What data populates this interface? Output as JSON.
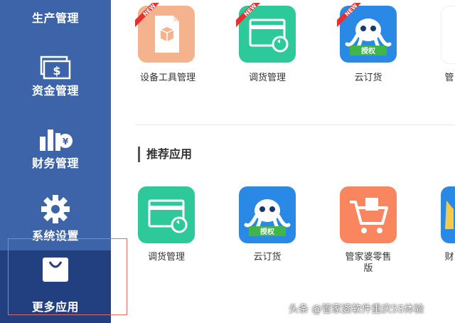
{
  "sidebar": {
    "items": [
      {
        "label": "生产管理",
        "icon": "production-icon"
      },
      {
        "label": "资金管理",
        "icon": "cash-icon"
      },
      {
        "label": "财务管理",
        "icon": "finance-chart-icon"
      },
      {
        "label": "系统设置",
        "icon": "gear-icon"
      },
      {
        "label": "更多应用",
        "icon": "shopping-bag-icon",
        "active": true
      }
    ]
  },
  "top_apps": [
    {
      "label": "设备工具管理",
      "badge": "NEW",
      "icon": "document-box-icon",
      "color": "#f4b38c"
    },
    {
      "label": "调货管理",
      "badge": "NEW",
      "icon": "card-refresh-icon",
      "color": "#2ec99a"
    },
    {
      "label": "云订货",
      "badge": "NEW",
      "icon": "octopus-mascot-icon",
      "color": "#2b89e6",
      "banner": "授权"
    },
    {
      "label": "管"
    }
  ],
  "recommended": {
    "title": "推荐应用",
    "apps": [
      {
        "label": "调货管理",
        "icon": "card-refresh-icon",
        "color": "#2ec99a"
      },
      {
        "label": "云订货",
        "icon": "octopus-mascot-icon",
        "color": "#2b89e6",
        "banner": "授权"
      },
      {
        "label": "管家婆零售版",
        "icon": "shopping-cart-icon",
        "color": "#f9865e"
      },
      {
        "label": "财",
        "color": "#2b89e6"
      }
    ]
  },
  "watermark": "头条 @管家婆软件重庆5S体验"
}
